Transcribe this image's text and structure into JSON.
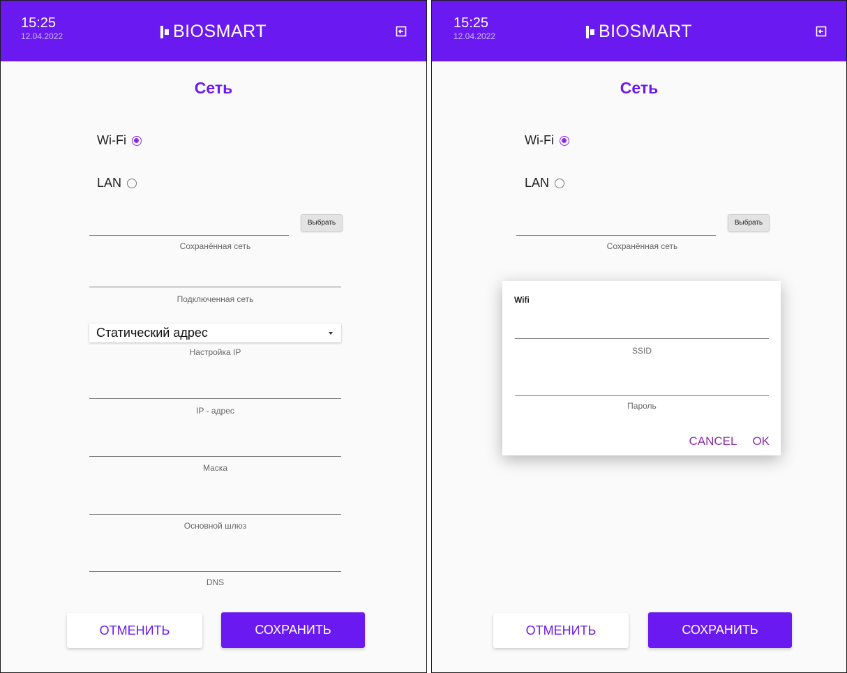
{
  "header": {
    "time": "15:25",
    "date": "12.04.2022",
    "logo_text": "BIOSMART",
    "exit_icon": "exit-icon"
  },
  "page_title": "Сеть",
  "network_type": {
    "options": [
      {
        "label": "Wi-Fi",
        "selected": true
      },
      {
        "label": "LAN",
        "selected": false
      }
    ]
  },
  "choose_button": "Выбрать",
  "fields": {
    "saved_network": "Сохранённая сеть",
    "connected_network": "Подключенная сеть",
    "ip_setup_value": "Статический адрес",
    "ip_setup_label": "Настройка IP",
    "ip_address": "IP - адрес",
    "mask": "Маска",
    "gateway": "Основной шлюз",
    "dns": "DNS"
  },
  "actions": {
    "cancel": "ОТМЕНИТЬ",
    "save": "СОХРАНИТЬ"
  },
  "wifi_dialog": {
    "title": "Wifi",
    "ssid_label": "SSID",
    "password_label": "Пароль",
    "cancel": "CANCEL",
    "ok": "OK"
  },
  "colors": {
    "accent": "#6a1af0",
    "radio": "#8a2be2",
    "dialog_action": "#8a2ba8"
  }
}
